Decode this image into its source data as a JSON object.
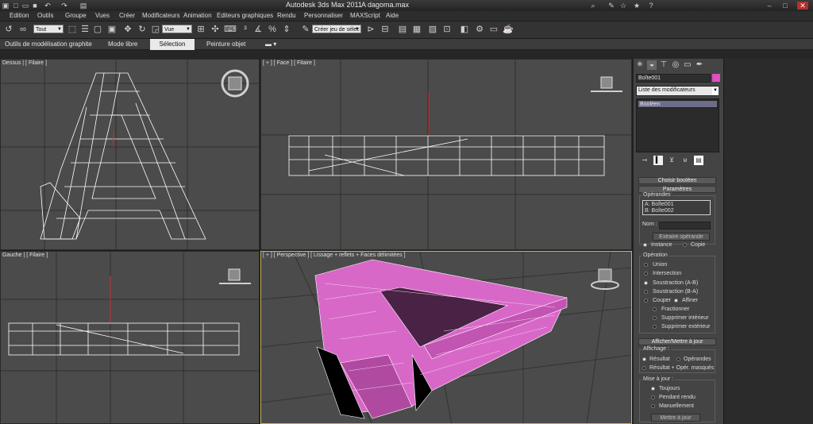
{
  "window": {
    "app_title": "Autodesk 3ds Max  2011",
    "file_name": "A dagoma.max"
  },
  "menu": [
    "Edition",
    "Outils",
    "Groupe",
    "Vues",
    "Créer",
    "Modificateurs",
    "Animation",
    "Editeurs graphiques",
    "Rendu",
    "Personnaliser",
    "MAXScript",
    "Aide"
  ],
  "toolbar": {
    "selection_filter": "Tout",
    "reference_coord": "Vue",
    "named_selection_placeholder": "Créer jeu de sélec"
  },
  "ribbon": {
    "tabs": [
      "Outils de modélisation graphite",
      "Mode libre",
      "Sélection",
      "Peinture objet"
    ],
    "active_tab": "Sélection"
  },
  "viewports": {
    "top": "Dessus | [ Filaire ]",
    "front": "[ + ] [ Face ] [ Filaire ]",
    "left": "Gauche | [ Filaire ]",
    "perspective": "[ + ] [ Perspective ] [ Lissage + reflets + Faces délimitées ]",
    "object_color": "#d868c8"
  },
  "command_panel": {
    "object_name": "Boîte001",
    "object_color": "#e050c0",
    "modifier_list": "Liste des modificateurs",
    "stack_item": "Booléen",
    "choose_boolean": "Choisir booléen",
    "params_title": "Paramètres",
    "operands_label": "Opérandes",
    "operand_a": "A: Boîte001",
    "operand_b": "B: Boîte002",
    "name_label": "Nom :",
    "extract_button": "Extraire opérande",
    "instance_label": "Instance",
    "copy_label": "Copie",
    "operation_label": "Opération",
    "operations": [
      "Union",
      "Intersection",
      "Soustraction (A-B)",
      "Soustraction (B-A)"
    ],
    "cut_label": "Couper",
    "refine_label": "Affiner",
    "cut_options": [
      "Fractionner",
      "Supprimer intérieur",
      "Supprimer extérieur"
    ],
    "display_rollout": "Afficher/Mettre à jour",
    "display_label": "Affichage :",
    "result_label": "Résultat",
    "operands_radio": "Opérandes",
    "result_hidden": "Résultat + Opér. masqués",
    "update_label": "Mise à jour :",
    "update_options": [
      "Toujours",
      "Pendant rendu",
      "Manuellement"
    ],
    "update_button": "Mettre à jour"
  }
}
